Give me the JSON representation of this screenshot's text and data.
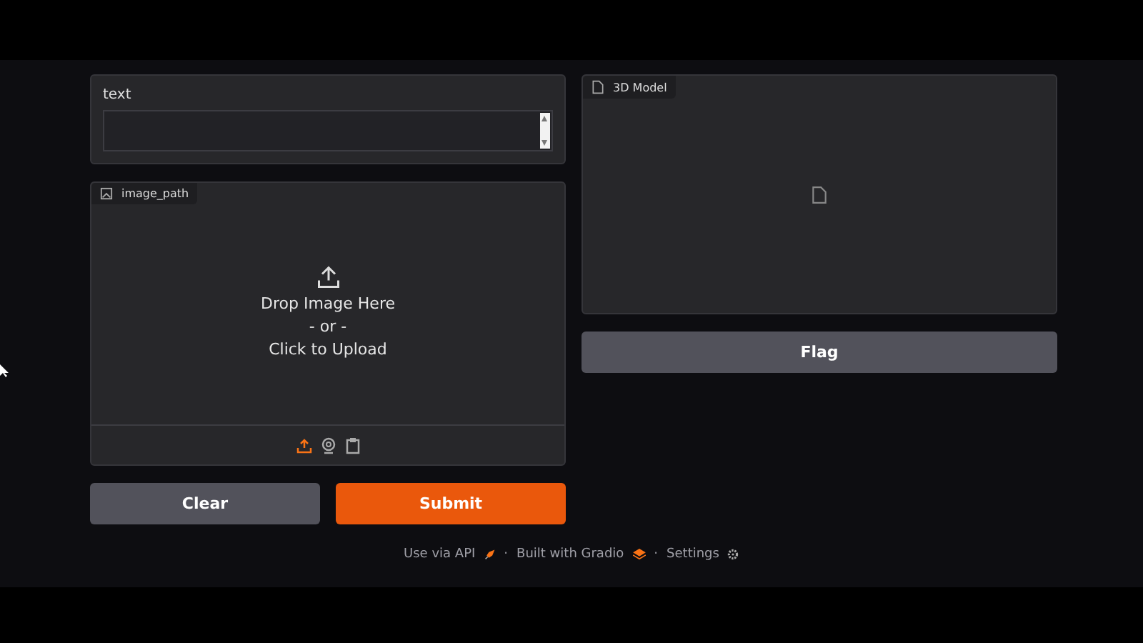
{
  "text_input": {
    "label": "text"
  },
  "image_input": {
    "label": "image_path",
    "drop_text": "Drop Image Here",
    "or_text": "- or -",
    "click_text": "Click to Upload",
    "sources": [
      {
        "kind": "upload",
        "selected": true
      },
      {
        "kind": "webcam",
        "selected": false
      },
      {
        "kind": "clipboard",
        "selected": false
      }
    ]
  },
  "buttons": [
    {
      "label": "Clear",
      "kind": "secondary"
    },
    {
      "label": "Submit",
      "kind": "primary"
    }
  ],
  "model_output": {
    "label": "3D Model"
  },
  "flag_button": {
    "label": "Flag"
  },
  "footer": {
    "separator": "·",
    "links": [
      {
        "label": "Use via API",
        "kind": "api"
      },
      {
        "label": "Built with Gradio",
        "kind": "gradio"
      },
      {
        "label": "Settings",
        "kind": "settings"
      }
    ]
  }
}
